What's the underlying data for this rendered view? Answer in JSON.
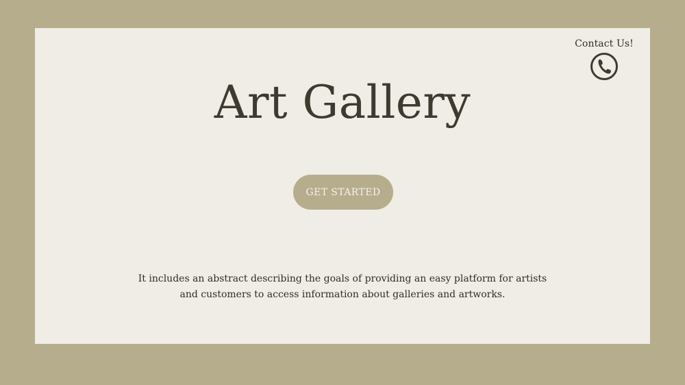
{
  "page": {
    "title": "Art Gallery",
    "contact_label": "Contact Us!",
    "contact_icon": "phone-icon",
    "cta_label": "GET STARTED",
    "abstract": "It includes an abstract describing the goals of providing an easy platform for artists and customers to access information about galleries and artworks."
  },
  "colors": {
    "background": "#b5ad8c",
    "card": "#f0ece6",
    "title": "#3e3a2f",
    "button": "#b5ad8c",
    "button_text": "#f5f2ea",
    "body_text": "#2f2c26"
  }
}
